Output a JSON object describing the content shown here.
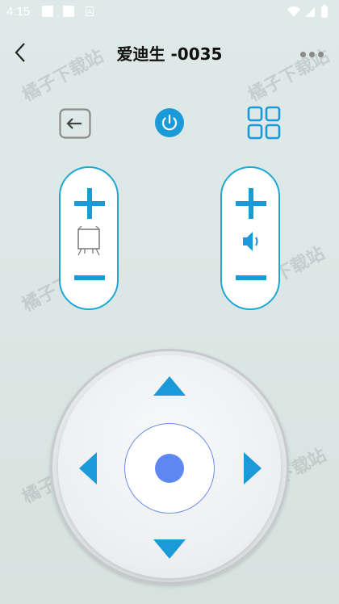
{
  "status_bar": {
    "time": "4:15",
    "notification_icon": "A"
  },
  "header": {
    "title": "爱迪生 -0035"
  },
  "icons": {
    "back": "chevron-left-icon",
    "more": "more-dots-icon",
    "input": "input-source-icon",
    "power": "power-icon",
    "menu": "grid-menu-icon",
    "channel": "tv-channel-icon",
    "volume": "speaker-icon"
  },
  "watermark": "橘子下载站",
  "colors": {
    "accent": "#1a9ad8",
    "ok": "#5f87f2",
    "pill_border": "#1ea7d6"
  }
}
